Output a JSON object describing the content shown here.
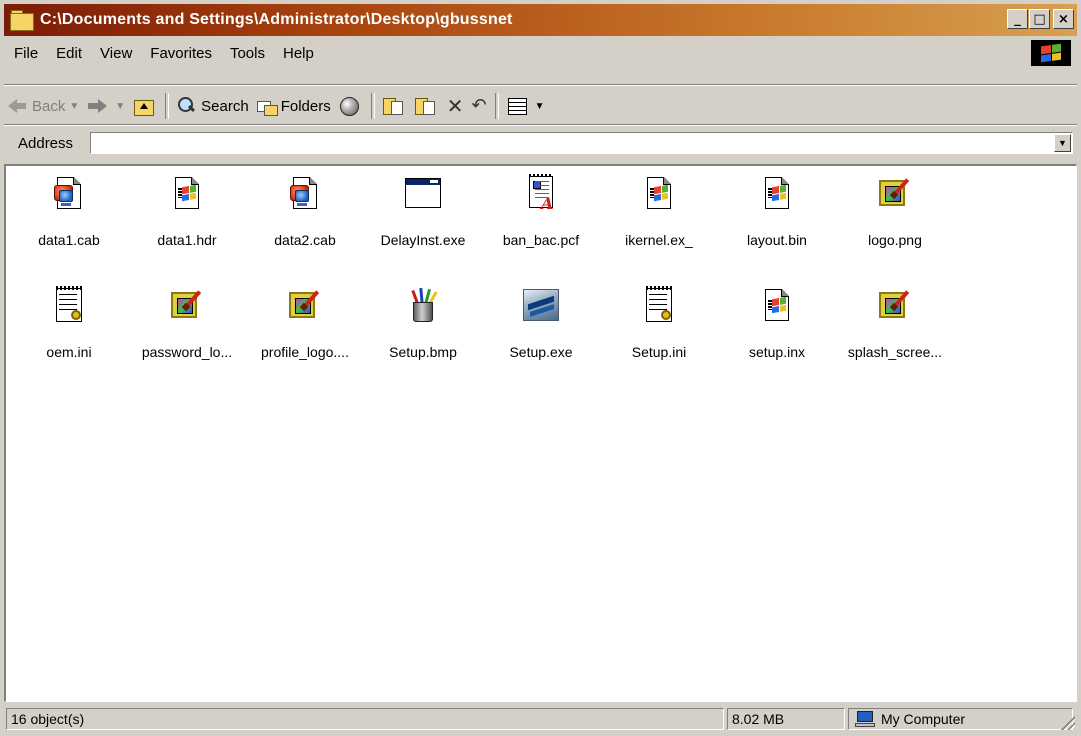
{
  "window": {
    "title": "C:\\Documents and Settings\\Administrator\\Desktop\\gbussnet",
    "controls": {
      "minimize": "_",
      "maximize": "□",
      "close": "×"
    }
  },
  "menu": [
    "File",
    "Edit",
    "View",
    "Favorites",
    "Tools",
    "Help"
  ],
  "toolbar": {
    "back_label": "Back",
    "search_label": "Search",
    "folders_label": "Folders"
  },
  "address": {
    "label": "Address",
    "value": ""
  },
  "files": [
    {
      "name": "data1.cab",
      "icon": "cab-file-icon"
    },
    {
      "name": "data1.hdr",
      "icon": "windows-file-icon"
    },
    {
      "name": "data2.cab",
      "icon": "cab-file-icon"
    },
    {
      "name": "DelayInst.exe",
      "icon": "exe-window-icon"
    },
    {
      "name": "ban_bac.pcf",
      "icon": "document-icon"
    },
    {
      "name": "ikernel.ex_",
      "icon": "windows-file-icon"
    },
    {
      "name": "layout.bin",
      "icon": "windows-file-icon"
    },
    {
      "name": "logo.png",
      "icon": "image-file-icon"
    },
    {
      "name": "oem.ini",
      "icon": "ini-file-icon"
    },
    {
      "name": "password_lo...",
      "icon": "image-file-icon"
    },
    {
      "name": "profile_logo....",
      "icon": "image-file-icon"
    },
    {
      "name": "Setup.bmp",
      "icon": "paint-bitmap-icon"
    },
    {
      "name": "Setup.exe",
      "icon": "setup-exe-icon"
    },
    {
      "name": "Setup.ini",
      "icon": "ini-file-icon"
    },
    {
      "name": "setup.inx",
      "icon": "windows-file-icon"
    },
    {
      "name": "splash_scree...",
      "icon": "image-file-icon"
    }
  ],
  "status": {
    "objects": "16 object(s)",
    "size": "8.02 MB",
    "zone": "My Computer"
  },
  "colors": {
    "titlebar_start": "#7a1b06",
    "titlebar_end": "#d8a050",
    "face": "#d4d0c8"
  }
}
